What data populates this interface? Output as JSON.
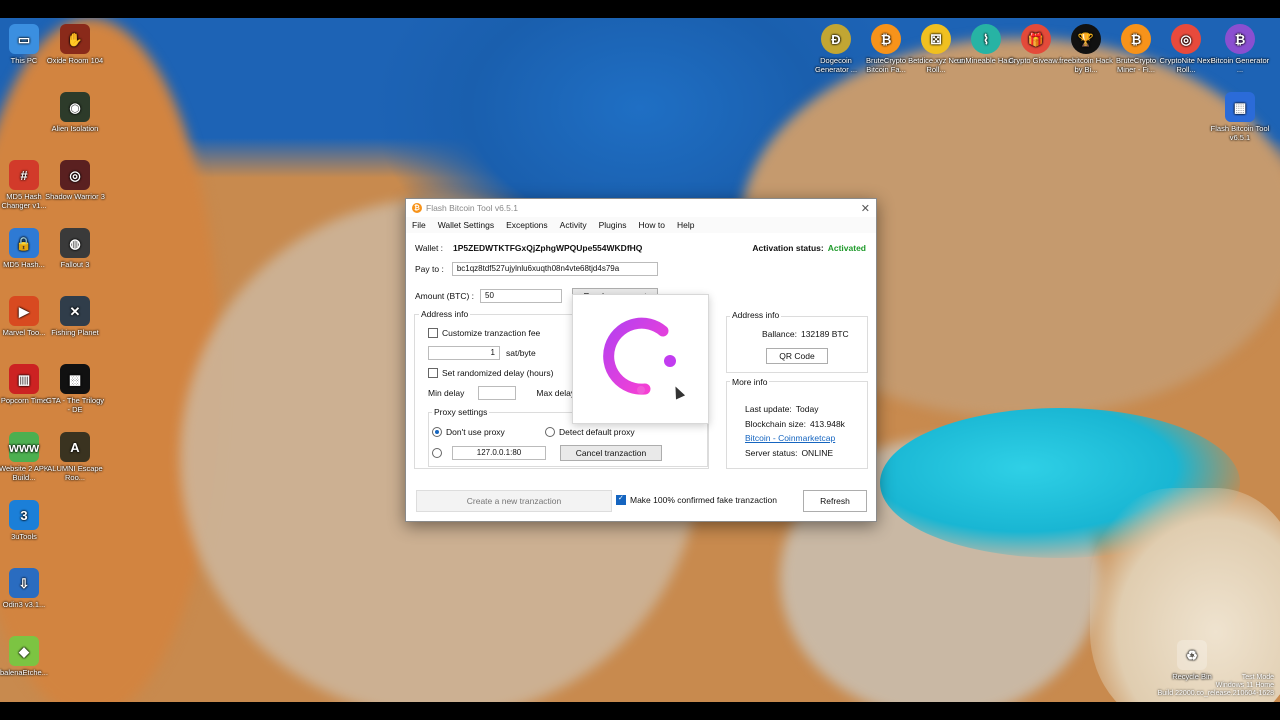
{
  "desktop": {
    "left_icons": [
      {
        "label": "This PC",
        "color": "#3b8fe0",
        "glyph": "▭",
        "icon": "monitor-icon"
      },
      {
        "label": "Oxide Room 104",
        "color": "#8a2a1a",
        "glyph": "✋",
        "icon": "game-icon"
      },
      {
        "label": "Alien Isolation",
        "color": "#2d3b2a",
        "glyph": "◉",
        "icon": "alien-icon"
      },
      {
        "label": "MD5 Hash Changer v1...",
        "color": "#d23a2a",
        "glyph": "#",
        "icon": "hash-icon"
      },
      {
        "label": "Shadow Warrior 3",
        "color": "#5a2020",
        "glyph": "◎",
        "icon": "game-icon"
      },
      {
        "label": "MD5 Hash...",
        "color": "#2e7ad4",
        "glyph": "🔒",
        "icon": "lock-icon"
      },
      {
        "label": "Fallout 3",
        "color": "#3a3a3a",
        "glyph": "◍",
        "icon": "game-icon"
      },
      {
        "label": "Marvel Too...",
        "color": "#d84a20",
        "glyph": "▶",
        "icon": "game-icon"
      },
      {
        "label": "Fishing Planet",
        "color": "#303d4a",
        "glyph": "✕",
        "icon": "game-icon"
      },
      {
        "label": "Popcorn Time",
        "color": "#c22",
        "glyph": "▥",
        "icon": "popcorn-icon"
      },
      {
        "label": "GTA - The Trilogy - DE",
        "color": "#111",
        "glyph": "▩",
        "icon": "game-icon"
      },
      {
        "label": "Website 2 APK Build...",
        "color": "#4caf50",
        "glyph": "www",
        "icon": "web-icon"
      },
      {
        "label": "ALUMNI Escape Roo...",
        "color": "#3a3320",
        "glyph": "A",
        "icon": "game-icon"
      },
      {
        "label": "3uTools",
        "color": "#1b7fd8",
        "glyph": "3",
        "icon": "tool-icon"
      },
      {
        "label": "Odin3 v3.1...",
        "color": "#2a6cc0",
        "glyph": "⇩",
        "icon": "download-icon"
      },
      {
        "label": "balenaEtche...",
        "color": "#7cc442",
        "glyph": "◆",
        "icon": "cube-icon"
      }
    ],
    "right_icons": [
      {
        "label": "Dogecoin Generator ...",
        "color": "#c2a633",
        "glyph": "Ð",
        "icon": "dogecoin-icon"
      },
      {
        "label": "BruteCrypto Bitcoin Fa...",
        "color": "#f7931a",
        "glyph": "₿",
        "icon": "bitcoin-icon"
      },
      {
        "label": "Betdice.xyz Next Roll...",
        "color": "#f0c020",
        "glyph": "⚄",
        "icon": "dice-icon"
      },
      {
        "label": "unMineable Hack",
        "color": "#27b3a4",
        "glyph": "⌇",
        "icon": "mining-icon"
      },
      {
        "label": "Crypto Giveaw...",
        "color": "#e34a3a",
        "glyph": "🎁",
        "icon": "gift-icon"
      },
      {
        "label": "freebitcoin Hack by Bi...",
        "color": "#111",
        "glyph": "🏆",
        "icon": "trophy-icon"
      },
      {
        "label": "BruteCrypto Miner - Fi...",
        "color": "#f7931a",
        "glyph": "₿",
        "icon": "bitcoin-icon"
      },
      {
        "label": "CryptoNite Next Roll...",
        "color": "#e84a3c",
        "glyph": "◎",
        "icon": "globe-icon"
      },
      {
        "label": "Bitcoin Generator ...",
        "color": "#8a4fd0",
        "glyph": "₿",
        "icon": "bitcoin-icon"
      },
      {
        "label": "Flash Bitcoin Tool v6.5.1",
        "color": "#2b6bd8",
        "glyph": "▦",
        "icon": "archive-icon"
      }
    ],
    "recycle_bin": "Recycle Bin",
    "watermark": [
      "Test Mode",
      "Windows 11 Home",
      "Build 22000.co_release.210604-1628"
    ]
  },
  "app": {
    "title": "Flash Bitcoin Tool v6.5.1",
    "menu": [
      "File",
      "Wallet Settings",
      "Exceptions",
      "Activity",
      "Plugins",
      "How to",
      "Help"
    ],
    "wallet_label": "Wallet :",
    "wallet_value": "1P5ZEDWTKTFGxQjZphgWPQUpe554WKDfHQ",
    "activation_label": "Activation status:",
    "activation_value": "Activated",
    "payto_label": "Pay to :",
    "payto_value": "bc1qz8tdf527ujylnlu6xuqth08n4vte68tjd4s79a",
    "amount_label": "Amount (BTC) :",
    "amount_value": "50",
    "random_amount": "Random amount",
    "left_group": {
      "title": "Address info",
      "custom_fee": "Customize tranzaction fee",
      "fee_value": "1",
      "fee_unit": "sat/byte",
      "random_delay": "Set randomized delay (hours)",
      "min_delay": "Min delay",
      "max_delay": "Max delay"
    },
    "proxy": {
      "title": "Proxy settings",
      "no_proxy": "Don't use proxy",
      "detect": "Detect default proxy",
      "address": "127.0.0.1:80",
      "cancel": "Cancel tranzaction"
    },
    "right_group1": {
      "title": "Address info",
      "balance_label": "Ballance:",
      "balance_value": "132189 BTC",
      "qr_button": "QR Code"
    },
    "right_group2": {
      "title": "More info",
      "last_update_label": "Last update:",
      "last_update_value": "Today",
      "chain_label": "Blockchain size:",
      "chain_value": "413.948k",
      "link": "Bitcoin - Coinmarketcap",
      "server_label": "Server status:",
      "server_value": "ONLINE"
    },
    "create_button": "Create a new tranzaction",
    "confirm_check": "Make 100% confirmed fake tranzaction",
    "refresh_button": "Refresh"
  }
}
